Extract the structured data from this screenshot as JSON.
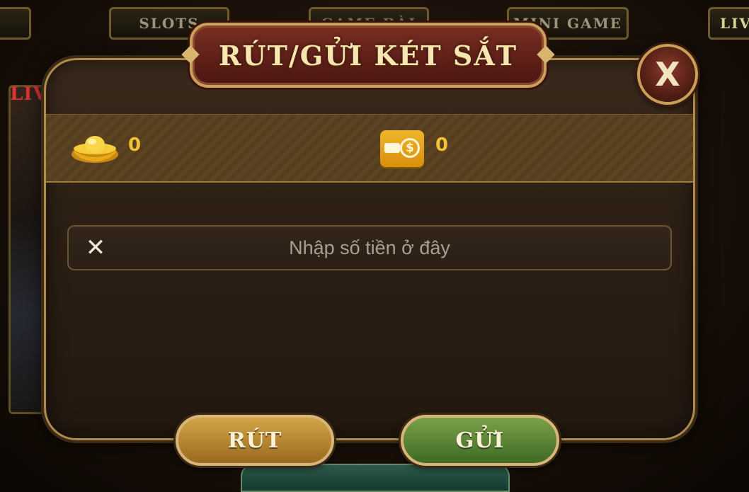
{
  "nav": {
    "tabs": [
      {
        "label": "SLOTS"
      },
      {
        "label": "GAME BÀI"
      },
      {
        "label": "MINI GAME"
      },
      {
        "label": "LIVE"
      }
    ]
  },
  "background": {
    "card_text": "LIVE"
  },
  "dialog": {
    "title": "RÚT/GỬI KÉT SẮT",
    "close_label": "X",
    "balances": {
      "gold": "0",
      "wallet": "0"
    },
    "amount_input": {
      "placeholder": "Nhập số tiền ở đây",
      "value": ""
    },
    "buttons": {
      "withdraw": "RÚT",
      "deposit": "GỬI"
    }
  },
  "colors": {
    "accent_gold": "#f2c232",
    "title_plate": "#7a2e22",
    "withdraw_button": "#d2a548",
    "deposit_button": "#7aa04a"
  },
  "icons": [
    "gold-ingot-icon",
    "wallet-icon",
    "clear-icon",
    "close-icon"
  ]
}
